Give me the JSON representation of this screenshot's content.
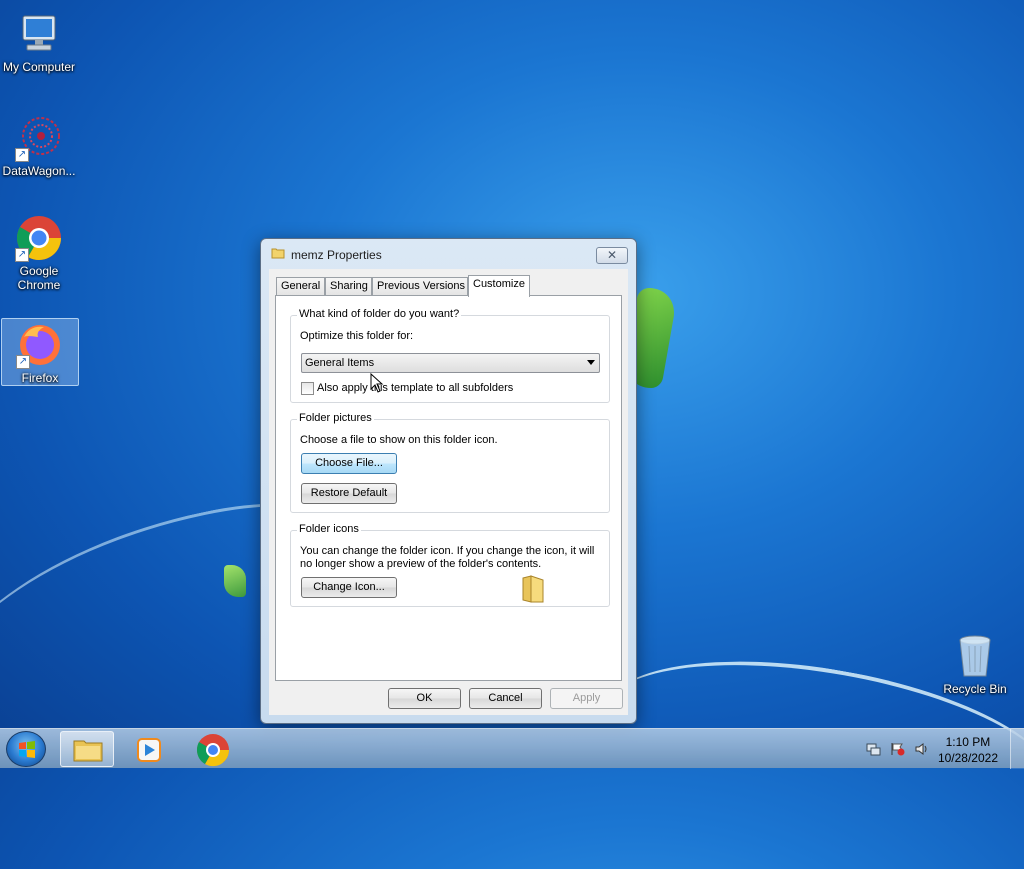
{
  "desktop": {
    "icons": [
      {
        "label": "My Computer"
      },
      {
        "label": "DataWagon..."
      },
      {
        "label": "Google Chrome"
      },
      {
        "label": "Firefox"
      },
      {
        "label": "Recycle Bin"
      }
    ]
  },
  "dialog": {
    "title": "memz Properties",
    "close_glyph": "✕",
    "tabs": [
      {
        "label": "General"
      },
      {
        "label": "Sharing"
      },
      {
        "label": "Previous Versions"
      },
      {
        "label": "Customize"
      }
    ],
    "active_tab": "Customize",
    "folder_type_group": {
      "legend": "What kind of folder do you want?",
      "optimize_label": "Optimize this folder for:",
      "optimize_value": "General Items",
      "subfolder_checkbox_label": "Also apply this template to all subfolders",
      "subfolder_checked": false
    },
    "folder_pictures_group": {
      "legend": "Folder pictures",
      "description": "Choose a file to show on this folder icon.",
      "choose_file_label": "Choose File...",
      "restore_default_label": "Restore Default"
    },
    "folder_icons_group": {
      "legend": "Folder icons",
      "description_line1": "You can change the folder icon. If you change the icon, it will",
      "description_line2": "no longer show a preview of the folder's contents.",
      "change_icon_label": "Change Icon..."
    },
    "buttons": {
      "ok": "OK",
      "cancel": "Cancel",
      "apply": "Apply"
    }
  },
  "taskbar": {
    "clock_time": "1:10 PM",
    "clock_date": "10/28/2022"
  },
  "colors": {
    "accent": "#3c7fb1",
    "desktop": "#1b76d2"
  }
}
